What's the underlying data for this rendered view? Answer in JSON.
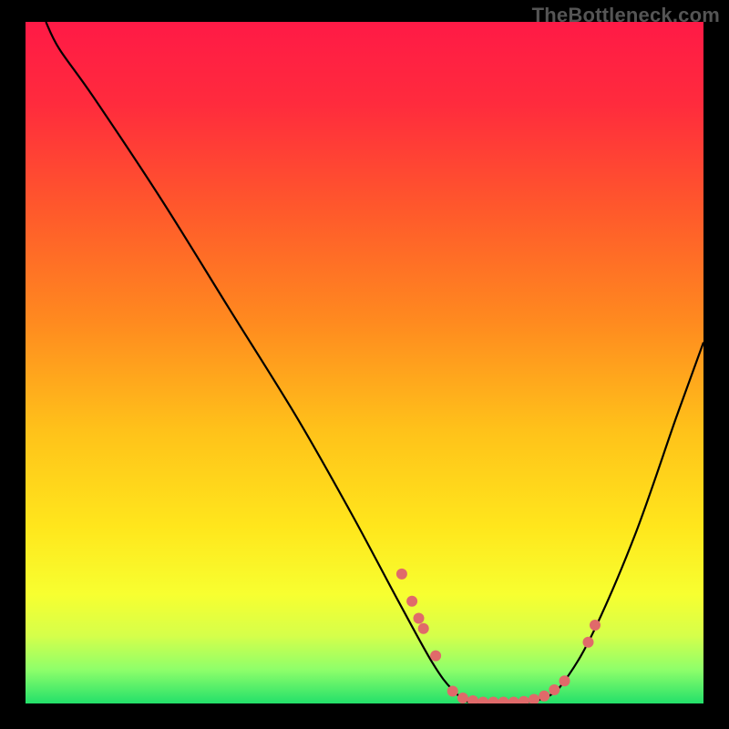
{
  "watermark": "TheBottleneck.com",
  "colors": {
    "gradient_stops": [
      {
        "offset": 0.0,
        "color": "#ff1a46"
      },
      {
        "offset": 0.12,
        "color": "#ff2b3d"
      },
      {
        "offset": 0.28,
        "color": "#ff5a2b"
      },
      {
        "offset": 0.44,
        "color": "#ff8a1f"
      },
      {
        "offset": 0.6,
        "color": "#ffc21a"
      },
      {
        "offset": 0.74,
        "color": "#ffe61c"
      },
      {
        "offset": 0.84,
        "color": "#f7ff30"
      },
      {
        "offset": 0.9,
        "color": "#d6ff4a"
      },
      {
        "offset": 0.95,
        "color": "#8fff6a"
      },
      {
        "offset": 1.0,
        "color": "#23e06a"
      }
    ],
    "curve_stroke": "#000000",
    "marker_fill": "#e06a6a",
    "marker_stroke": "#b94f4f"
  },
  "chart_data": {
    "type": "line",
    "title": "",
    "xlabel": "",
    "ylabel": "",
    "x_range": [
      0,
      100
    ],
    "y_range": [
      0,
      100
    ],
    "curve_points": [
      {
        "x": 3,
        "y": 100
      },
      {
        "x": 5,
        "y": 96
      },
      {
        "x": 10,
        "y": 89
      },
      {
        "x": 20,
        "y": 74
      },
      {
        "x": 30,
        "y": 58
      },
      {
        "x": 40,
        "y": 42
      },
      {
        "x": 48,
        "y": 28
      },
      {
        "x": 55,
        "y": 15
      },
      {
        "x": 60,
        "y": 6
      },
      {
        "x": 63,
        "y": 2
      },
      {
        "x": 66,
        "y": 0
      },
      {
        "x": 72,
        "y": 0
      },
      {
        "x": 77,
        "y": 1
      },
      {
        "x": 80,
        "y": 4
      },
      {
        "x": 84,
        "y": 11
      },
      {
        "x": 90,
        "y": 25
      },
      {
        "x": 96,
        "y": 42
      },
      {
        "x": 100,
        "y": 53
      }
    ],
    "markers": [
      {
        "x": 55.5,
        "y": 19.0
      },
      {
        "x": 57.0,
        "y": 15.0
      },
      {
        "x": 58.0,
        "y": 12.5
      },
      {
        "x": 58.7,
        "y": 11.0
      },
      {
        "x": 60.5,
        "y": 7.0
      },
      {
        "x": 63.0,
        "y": 1.8
      },
      {
        "x": 64.5,
        "y": 0.8
      },
      {
        "x": 66.0,
        "y": 0.4
      },
      {
        "x": 67.5,
        "y": 0.2
      },
      {
        "x": 69.0,
        "y": 0.2
      },
      {
        "x": 70.5,
        "y": 0.2
      },
      {
        "x": 72.0,
        "y": 0.2
      },
      {
        "x": 73.5,
        "y": 0.3
      },
      {
        "x": 75.0,
        "y": 0.6
      },
      {
        "x": 76.5,
        "y": 1.1
      },
      {
        "x": 78.0,
        "y": 2.0
      },
      {
        "x": 79.5,
        "y": 3.3
      },
      {
        "x": 83.0,
        "y": 9.0
      },
      {
        "x": 84.0,
        "y": 11.5
      }
    ],
    "marker_radius_px": 6,
    "note": "y is bottleneck percent (0 = optimal); curve reaches minimum near x≈66–72 then rises."
  }
}
